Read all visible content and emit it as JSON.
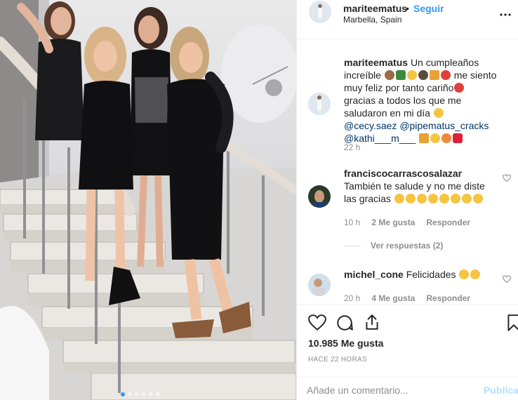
{
  "post": {
    "author": "mariteematus",
    "separator": "•",
    "follow_label": "Seguir",
    "location": "Marbella, Spain",
    "caption_text": "Un cumpleaños increíble",
    "caption_text_2": "me siento muy feliz por tanto cariño",
    "caption_text_3": "gracias a todos los que me saludaron en mi día",
    "mention_1": "@cecy.saez",
    "mention_2": "@pipematus_cracks",
    "mention_3": "@kathi___m___",
    "caption_time": "22 h"
  },
  "comments": [
    {
      "user": "franciscocarrascosalazar",
      "text": "También te salude y no me diste las gracias",
      "time": "10 h",
      "likes": "2 Me gusta",
      "reply": "Responder"
    },
    {
      "user": "michel_cone",
      "text": "Felicidades",
      "time": "20 h",
      "likes": "4 Me gusta",
      "reply": "Responder"
    }
  ],
  "view_replies": "Ver respuestas (2)",
  "footer": {
    "likes": "10.985 Me gusta",
    "timestamp": "HACE 22 HORAS",
    "comment_placeholder": "Añade un comentario...",
    "post_label": "Publicar"
  },
  "icons": {
    "like": "heart-icon",
    "comment": "comment-icon",
    "share": "share-icon",
    "save": "bookmark-icon",
    "more": "more-options-icon"
  },
  "colors": {
    "accent": "#3897f0",
    "secondary_text": "#8e8e8e",
    "mention": "#003569"
  }
}
